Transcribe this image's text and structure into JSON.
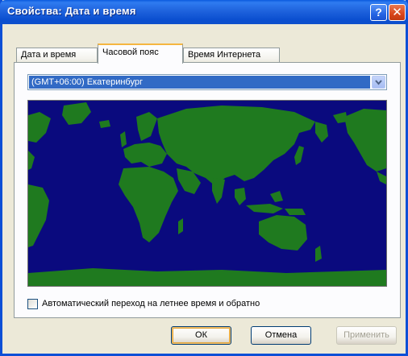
{
  "window": {
    "title": "Свойства: Дата и время",
    "help_glyph": "?",
    "close_glyph": "✕"
  },
  "tabs": [
    {
      "label": "Дата и время",
      "active": false
    },
    {
      "label": "Часовой пояс",
      "active": true
    },
    {
      "label": "Время Интернета",
      "active": false
    }
  ],
  "timezone": {
    "selected": "(GMT+06:00) Екатеринбург"
  },
  "map": {
    "ocean_color": "#0a0a7e",
    "land_color": "#1f7a1f"
  },
  "dst": {
    "checked": false,
    "label": "Автоматический переход на летнее время и обратно"
  },
  "buttons": {
    "ok": "ОК",
    "cancel": "Отмена",
    "apply": "Применить"
  },
  "icons": {
    "help": "help-icon",
    "close": "close-icon",
    "dropdown": "chevron-down-icon"
  }
}
